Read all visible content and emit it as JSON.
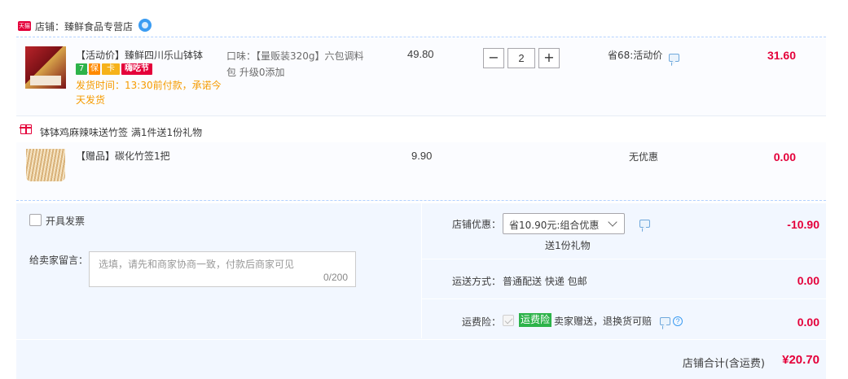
{
  "shop": {
    "tmall_badge": "天猫",
    "label": "店铺：臻鲜食品专营店"
  },
  "item1": {
    "title": "【活动价】臻鲜四川乐山钵钵鸡...",
    "badges": [
      "7",
      "保",
      "卡",
      "嗨吃节"
    ],
    "ship_time": "发货时间：13:30前付款，承诺今天发货",
    "sku": "口味：【量贩装320g】六包调料包 升级0添加",
    "unit_price": "49.80",
    "minus": "−",
    "qty": "2",
    "plus": "+",
    "promo": "省68:活动价",
    "total": "31.60"
  },
  "gift": {
    "name": "钵钵鸡麻辣味送竹签    满1件送1份礼物",
    "title": "【赠品】碳化竹签1把",
    "price": "9.90",
    "promo": "无优惠",
    "total": "0.00"
  },
  "order": {
    "invoice_label": "开具发票",
    "memo_label": "给卖家留言：",
    "memo_placeholder": "选填，请先和商家协商一致，付款后商家可见",
    "memo_count": "0/200",
    "discount_label": "店铺优惠：",
    "discount_select": "省10.90元:组合优惠",
    "discount_sub": "送1份礼物",
    "discount_amount": "-10.90",
    "shipping_label": "运送方式：",
    "shipping_value": "普通配送 快递 包邮",
    "shipping_amount": "0.00",
    "insurance_label": "运费险：",
    "insurance_tag": "运费险",
    "insurance_text": "卖家赠送，退换货可赔",
    "insurance_amount": "0.00",
    "help": "?",
    "total_label": "店铺合计(含运费)",
    "total_value": "¥20.70"
  }
}
